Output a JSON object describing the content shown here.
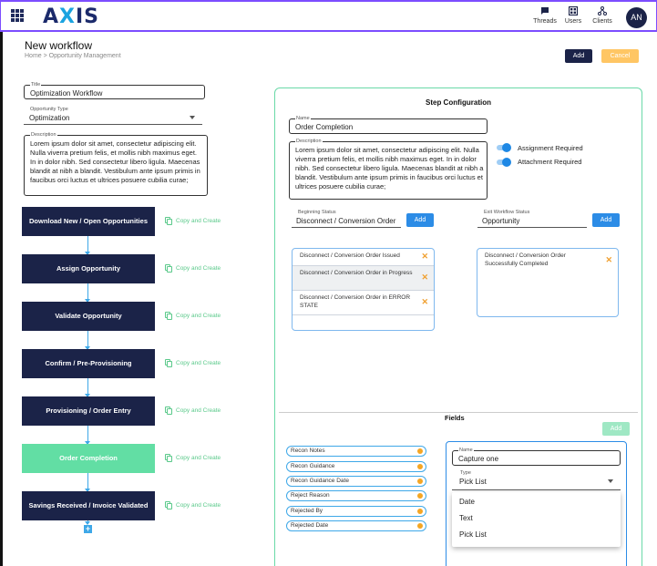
{
  "header": {
    "logo": "AXIS",
    "nav": [
      {
        "label": "Threads",
        "icon": "chat-icon"
      },
      {
        "label": "Users",
        "icon": "grid-users-icon"
      },
      {
        "label": "Clients",
        "icon": "network-icon"
      }
    ],
    "avatar_initials": "AN",
    "accent_color": "#7c4dff"
  },
  "page": {
    "title": "New workflow",
    "breadcrumb": "Home > Opportunity Management",
    "add_label": "Add",
    "cancel_label": "Cancel"
  },
  "form": {
    "title_label": "Title",
    "title_value": "Optimization Workflow",
    "type_label": "Opportunity Type",
    "type_value": "Optimization",
    "description_label": "Description",
    "description_value": "Lorem ipsum dolor sit amet, consectetur adipiscing elit. Nulla viverra pretium felis, et mollis nibh maximus eget. In in dolor nibh. Sed consectetur libero ligula. Maecenas blandit at nibh a blandit. Vestibulum ante ipsum primis in faucibus orci luctus et ultrices posuere cubilia curae;"
  },
  "steps": {
    "copy_label": "Copy and Create",
    "items": [
      {
        "label": "Download New / Open Opportunities"
      },
      {
        "label": "Assign Opportunity"
      },
      {
        "label": "Validate Opportunity"
      },
      {
        "label": "Confirm / Pre-Provisioning"
      },
      {
        "label": "Provisioning / Order Entry"
      },
      {
        "label": "Order Completion"
      },
      {
        "label": "Savings Received / Invoice Validated"
      }
    ],
    "active_index": 5
  },
  "config": {
    "heading": "Step Configuration",
    "name_label": "Name",
    "name_value": "Order Completion",
    "description_label": "Description",
    "description_value": "Lorem ipsum dolor sit amet, consectetur adipiscing elit. Nulla viverra pretium felis, et mollis nibh maximus eget. In in dolor nibh. Sed consectetur libero ligula. Maecenas blandit at nibh a blandit. Vestibulum ante ipsum primis in faucibus orci luctus et ultrices posuere cubilia curae;",
    "assignment_required_label": "Assignment Required",
    "attachment_required_label": "Attachment Required",
    "beginning_status_label": "Beginning Status",
    "beginning_status_value": "Disconnect / Conversion Order",
    "exit_status_label": "Exit Workflow Status",
    "exit_status_value": "Opportunity",
    "add_label": "Add",
    "beginning_statuses": [
      "Disconnect / Conversion Order Issued",
      "Disconnect / Conversion Order in Progress",
      "Disconnect / Conversion Order in ERROR STATE"
    ],
    "exit_statuses": [
      "Disconnect / Conversion Order Successfully Completed"
    ],
    "remove_symbol": "✕"
  },
  "fields": {
    "heading": "Fields",
    "add_label": "Add",
    "items": [
      "Recon Notes",
      "Recon Guidance",
      "Recon Guidance Date",
      "Reject Reason",
      "Rejected By",
      "Rejected Date"
    ],
    "editor": {
      "name_label": "Name",
      "name_value": "Capture one",
      "type_label": "Type",
      "type_value": "Pick List",
      "options": [
        "Date",
        "Text",
        "Pick List"
      ]
    }
  }
}
